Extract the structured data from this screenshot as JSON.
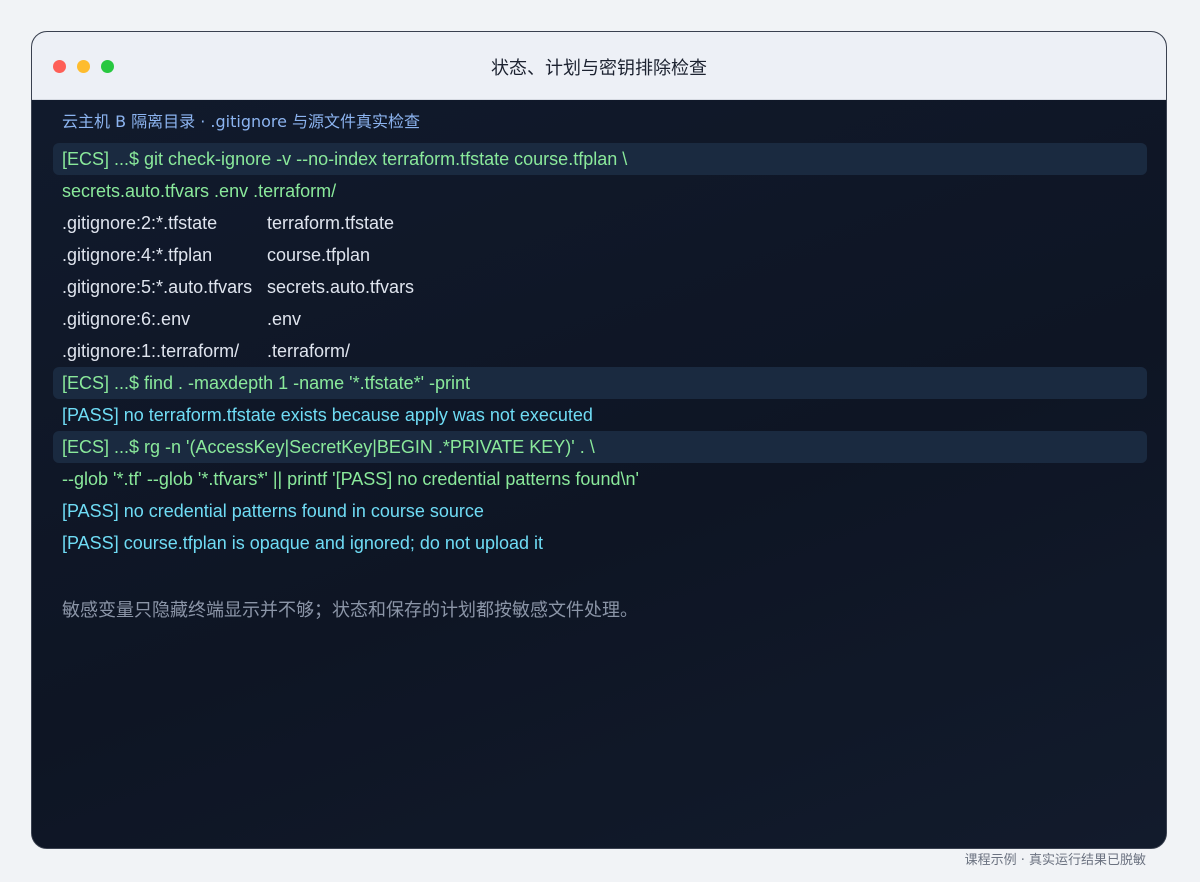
{
  "window": {
    "title": "状态、计划与密钥排除检查"
  },
  "terminal": {
    "subtitle": "云主机 B 隔离目录 · .gitignore 与源文件真实检查",
    "lines": [
      {
        "kind": "cmd",
        "text": "[ECS] ...$ git check-ignore -v --no-index terraform.tfstate course.tfplan \\"
      },
      {
        "kind": "cont",
        "text": "secrets.auto.tfvars .env .terraform/"
      },
      {
        "kind": "out",
        "rule": ".gitignore:2:*.tfstate",
        "path": "terraform.tfstate"
      },
      {
        "kind": "out",
        "rule": ".gitignore:4:*.tfplan",
        "path": "course.tfplan"
      },
      {
        "kind": "out",
        "rule": ".gitignore:5:*.auto.tfvars",
        "path": "secrets.auto.tfvars"
      },
      {
        "kind": "out",
        "rule": ".gitignore:6:.env",
        "path": ".env"
      },
      {
        "kind": "out",
        "rule": ".gitignore:1:.terraform/",
        "path": ".terraform/"
      },
      {
        "kind": "cmd",
        "text": "[ECS] ...$ find . -maxdepth 1 -name '*.tfstate*' -print"
      },
      {
        "kind": "pass",
        "text": "[PASS] no terraform.tfstate exists because apply was not executed"
      },
      {
        "kind": "cmd",
        "text": "[ECS] ...$ rg -n '(AccessKey|SecretKey|BEGIN .*PRIVATE KEY)' . \\"
      },
      {
        "kind": "cont",
        "text": "--glob '*.tf' --glob '*.tfvars*' || printf '[PASS] no credential patterns found\\n'"
      },
      {
        "kind": "pass",
        "text": "[PASS] no credential patterns found in course source"
      },
      {
        "kind": "pass",
        "text": "[PASS] course.tfplan is opaque and ignored; do not upload it"
      }
    ],
    "note": "敏感变量只隐藏终端显示并不够；状态和保存的计划都按敏感文件处理。"
  },
  "footer": {
    "caption": "课程示例 · 真实运行结果已脱敏"
  },
  "colors": {
    "command": "#8ae99b",
    "output": "#dfe4ee",
    "pass": "#6fdcf5",
    "subtitle": "#8cb4f0",
    "note": "#8b95a7"
  }
}
